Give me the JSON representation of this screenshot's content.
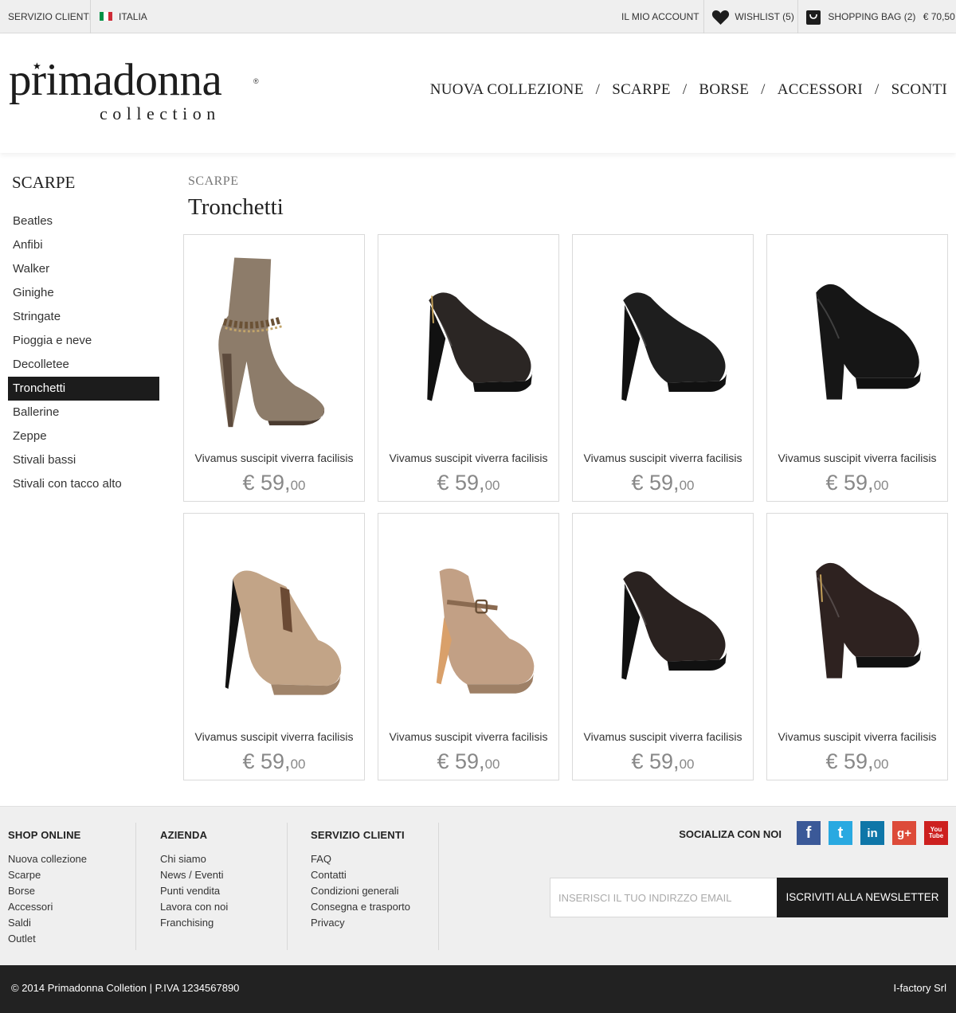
{
  "topbar": {
    "customer_service": "SERVIZIO CLIENTI",
    "country": "ITALIA",
    "account": "IL MIO ACCOUNT",
    "wishlist": "WISHLIST",
    "wishlist_count": "(5)",
    "bag": "SHOPPING BAG",
    "bag_count": "(2)",
    "bag_total": "€ 70,50"
  },
  "header": {
    "logo_main": "primadonna",
    "logo_sub": "collection",
    "nav": [
      "NUOVA COLLEZIONE",
      "SCARPE",
      "BORSE",
      "ACCESSORI",
      "SCONTI"
    ],
    "nav_separator": "/"
  },
  "sidebar": {
    "title": "SCARPE",
    "items": [
      "Beatles",
      "Anfibi",
      "Walker",
      "Ginighe",
      "Stringate",
      "Pioggia e neve",
      "Decolletee",
      "Tronchetti",
      "Ballerine",
      "Zeppe",
      "Stivali bassi",
      "Stivali con tacco alto"
    ],
    "active_index": 7
  },
  "content": {
    "breadcrumb": "SCARPE",
    "title": "Tronchetti"
  },
  "products": [
    {
      "name": "Vivamus suscipit viverra facilisis",
      "price_main": "€ 59,",
      "price_cents": "00",
      "shoe": "taupe-boot",
      "color": "#8d7c6a"
    },
    {
      "name": "Vivamus suscipit viverra facilisis",
      "price_main": "€ 59,",
      "price_cents": "00",
      "shoe": "bootie-zip",
      "color": "#2b2624"
    },
    {
      "name": "Vivamus suscipit viverra facilisis",
      "price_main": "€ 59,",
      "price_cents": "00",
      "shoe": "bootie",
      "color": "#1e1e1e"
    },
    {
      "name": "Vivamus suscipit viverra facilisis",
      "price_main": "€ 59,",
      "price_cents": "00",
      "shoe": "bootie-chunky",
      "color": "#161616"
    },
    {
      "name": "Vivamus suscipit viverra facilisis",
      "price_main": "€ 59,",
      "price_cents": "00",
      "shoe": "chelsea-platform",
      "color": "#c2a487"
    },
    {
      "name": "Vivamus suscipit viverra facilisis",
      "price_main": "€ 59,",
      "price_cents": "00",
      "shoe": "buckle-bootie",
      "color": "#c2a085"
    },
    {
      "name": "Vivamus suscipit viverra facilisis",
      "price_main": "€ 59,",
      "price_cents": "00",
      "shoe": "bootie",
      "color": "#2a2220"
    },
    {
      "name": "Vivamus suscipit viverra facilisis",
      "price_main": "€ 59,",
      "price_cents": "00",
      "shoe": "bootie-chunky-zip",
      "color": "#2e2220"
    }
  ],
  "footer": {
    "shop": {
      "title": "SHOP ONLINE",
      "links": [
        "Nuova collezione",
        "Scarpe",
        "Borse",
        "Accessori",
        "Saldi",
        "Outlet"
      ]
    },
    "company": {
      "title": "AZIENDA",
      "links": [
        "Chi siamo",
        "News / Eventi",
        "Punti vendita",
        "Lavora con noi",
        "Franchising"
      ]
    },
    "service": {
      "title": "SERVIZIO CLIENTI",
      "links": [
        "FAQ",
        "Contatti",
        "Condizioni generali",
        "Consegna e trasporto",
        "Privacy"
      ]
    },
    "social_label": "SOCIALIZA CON NOI",
    "social": [
      {
        "name": "facebook-icon",
        "glyph": "f",
        "color": "#3b5998"
      },
      {
        "name": "twitter-icon",
        "glyph": "t",
        "color": "#29a9e1"
      },
      {
        "name": "linkedin-icon",
        "glyph": "in",
        "color": "#0e76a8"
      },
      {
        "name": "googleplus-icon",
        "glyph": "g+",
        "color": "#dd4b39"
      },
      {
        "name": "youtube-icon",
        "glyph": "You Tube",
        "color": "#cd201f"
      }
    ],
    "newsletter_placeholder": "INSERISCI IL TUO INDIRZZO EMAIL",
    "newsletter_button": "ISCRIVITI ALLA NEWSLETTER",
    "copyright": "© 2014 Primadonna Colletion | P.IVA 1234567890",
    "credit": "I-factory Srl"
  },
  "colors": {
    "topbar_bg": "#efefef",
    "active_bg": "#1c1c1c",
    "footer_bg": "#efefef",
    "bottombar_bg": "#222222"
  }
}
